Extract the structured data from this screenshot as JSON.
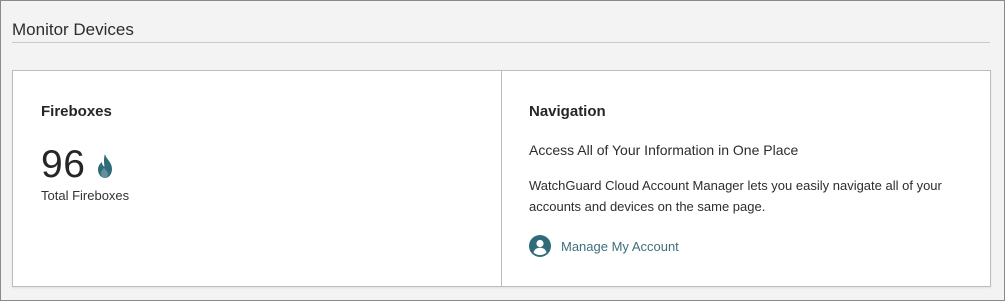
{
  "page": {
    "section_title": "Monitor Devices"
  },
  "fireboxes": {
    "title": "Fireboxes",
    "count": "96",
    "count_label": "Total Fireboxes",
    "icon": "flame-icon"
  },
  "navigation": {
    "title": "Navigation",
    "subtitle": "Access All of Your Information in One Place",
    "description": "WatchGuard Cloud Account Manager lets you easily navigate all of your accounts and devices on the same page.",
    "link_label": "Manage My Account",
    "link_icon": "account-circle-icon"
  },
  "colors": {
    "accent": "#2f6b78",
    "link": "#3f6f7d"
  }
}
